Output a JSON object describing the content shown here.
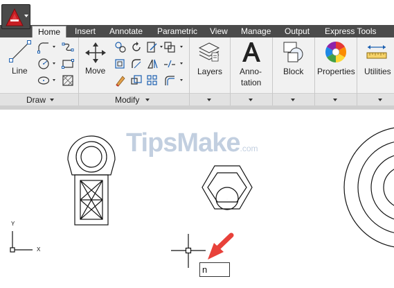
{
  "tabs": [
    {
      "label": "Home",
      "active": true
    },
    {
      "label": "Insert"
    },
    {
      "label": "Annotate"
    },
    {
      "label": "Parametric"
    },
    {
      "label": "View"
    },
    {
      "label": "Manage"
    },
    {
      "label": "Output"
    },
    {
      "label": "Express Tools"
    }
  ],
  "ribbon": {
    "draw": {
      "line_label": "Line",
      "footer": "Draw"
    },
    "modify": {
      "move_label": "Move",
      "footer": "Modify"
    },
    "layers_label": "Layers",
    "annotation_label_1": "Anno-",
    "annotation_label_2": "tation",
    "block_label": "Block",
    "properties_label": "Properties",
    "utilities_label": "Utilities"
  },
  "canvas": {
    "watermark": "TipsMake",
    "watermark_suffix": ".com",
    "ucs_y": "Y",
    "ucs_x": "X",
    "command_value": "n"
  },
  "colors": {
    "tab_bar": "#4b4b4b",
    "ribbon_bg": "#f1f1f1",
    "arrow": "#e8413a",
    "app_red": "#d32027"
  }
}
